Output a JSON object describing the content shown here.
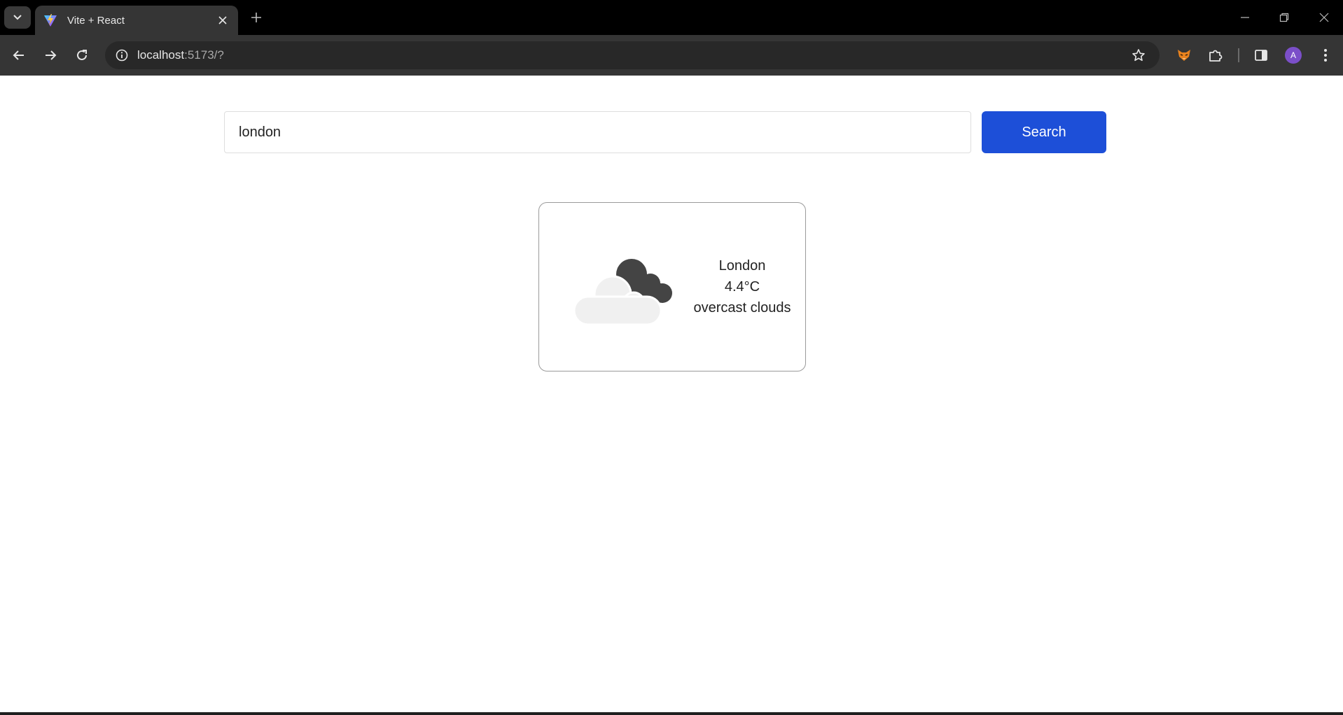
{
  "browser": {
    "tab_title": "Vite + React",
    "url_host": "localhost",
    "url_rest": ":5173/?",
    "profile_initial": "A",
    "accent_profile": "#7b4fc9",
    "icons": [
      "tab-search-icon",
      "vite-favicon-icon",
      "close-icon",
      "plus-icon",
      "minimize-icon",
      "restore-icon",
      "window-close-icon",
      "back-icon",
      "forward-icon",
      "reload-icon",
      "info-icon",
      "star-icon",
      "fox-extension-icon",
      "puzzle-extensions-icon",
      "side-panel-icon",
      "more-vert-icon"
    ]
  },
  "search": {
    "value": "london",
    "button_label": "Search",
    "button_color": "#1d4fd8"
  },
  "weather": {
    "city": "London",
    "temperature": "4.4°C",
    "description": "overcast clouds",
    "icon": "overcast-clouds-icon"
  }
}
